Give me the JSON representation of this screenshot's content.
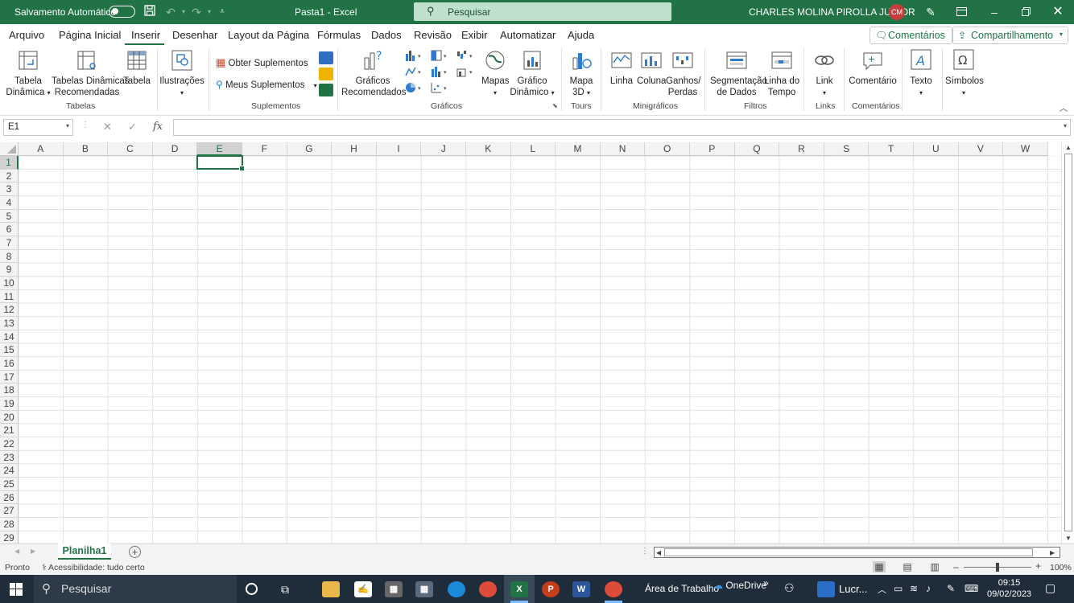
{
  "titlebar": {
    "autosave_label": "Salvamento Automático",
    "doc_title": "Pasta1  -  Excel",
    "search_label": "Pesquisar",
    "user_name": "CHARLES MOLINA PIROLLA JUNIOR",
    "avatar_initials": "CM"
  },
  "menu": {
    "tabs": [
      "Arquivo",
      "Página Inicial",
      "Inserir",
      "Desenhar",
      "Layout da Página",
      "Fórmulas",
      "Dados",
      "Revisão",
      "Exibir",
      "Automatizar",
      "Ajuda"
    ],
    "active": "Inserir",
    "comments_label": "Comentários",
    "share_label": "Compartilhamento"
  },
  "ribbon": {
    "tabela_dinamica_1": "Tabela",
    "tabela_dinamica_2": "Dinâmica",
    "tabelas_dinamicas_rec_1": "Tabelas Dinâmicas",
    "tabelas_dinamicas_rec_2": "Recomendadas",
    "tabela": "Tabela",
    "group_tabelas": "Tabelas",
    "ilustracoes": "Ilustrações",
    "obter_suplementos": "Obter Suplementos",
    "meus_suplementos": "Meus Suplementos",
    "group_suplementos": "Suplementos",
    "graficos_rec_1": "Gráficos",
    "graficos_rec_2": "Recomendados",
    "mapas": "Mapas",
    "grafico_dinamico_1": "Gráfico",
    "grafico_dinamico_2": "Dinâmico",
    "group_graficos": "Gráficos",
    "mapa3d_1": "Mapa",
    "mapa3d_2": "3D",
    "group_tours": "Tours",
    "linha": "Linha",
    "coluna": "Coluna",
    "ganhos_1": "Ganhos/",
    "ganhos_2": "Perdas",
    "group_minigraficos": "Minigráficos",
    "segmentacao_1": "Segmentação",
    "segmentacao_2": "de Dados",
    "linha_tempo_1": "Linha do",
    "linha_tempo_2": "Tempo",
    "group_filtros": "Filtros",
    "link": "Link",
    "group_links": "Links",
    "comentario": "Comentário",
    "group_comentarios": "Comentários",
    "texto": "Texto",
    "simbolos": "Símbolos"
  },
  "formula_bar": {
    "name_box": "E1",
    "fx": "fx",
    "value": ""
  },
  "grid": {
    "columns": [
      "A",
      "B",
      "C",
      "D",
      "E",
      "F",
      "G",
      "H",
      "I",
      "J",
      "K",
      "L",
      "M",
      "N",
      "O",
      "P",
      "Q",
      "R",
      "S",
      "T",
      "U",
      "V",
      "W"
    ],
    "rows": [
      "1",
      "2",
      "3",
      "4",
      "5",
      "6",
      "7",
      "8",
      "9",
      "10",
      "11",
      "12",
      "13",
      "14",
      "15",
      "16",
      "17",
      "18",
      "19",
      "20",
      "21",
      "22",
      "23",
      "24",
      "25",
      "26",
      "27",
      "28",
      "29"
    ],
    "selected_column": "E",
    "selected_row": "1"
  },
  "sheets": {
    "tabs": [
      "Planilha1"
    ]
  },
  "status": {
    "ready": "Pronto",
    "accessibility": "Acessibilidade: tudo certo",
    "zoom": "100%"
  },
  "taskbar": {
    "search_label": "Pesquisar",
    "desktop_label": "Área de Trabalho",
    "onedrive_label": "OneDrive",
    "lucro_label": "Lucr...",
    "time": "09:15",
    "date": "09/02/2023"
  }
}
